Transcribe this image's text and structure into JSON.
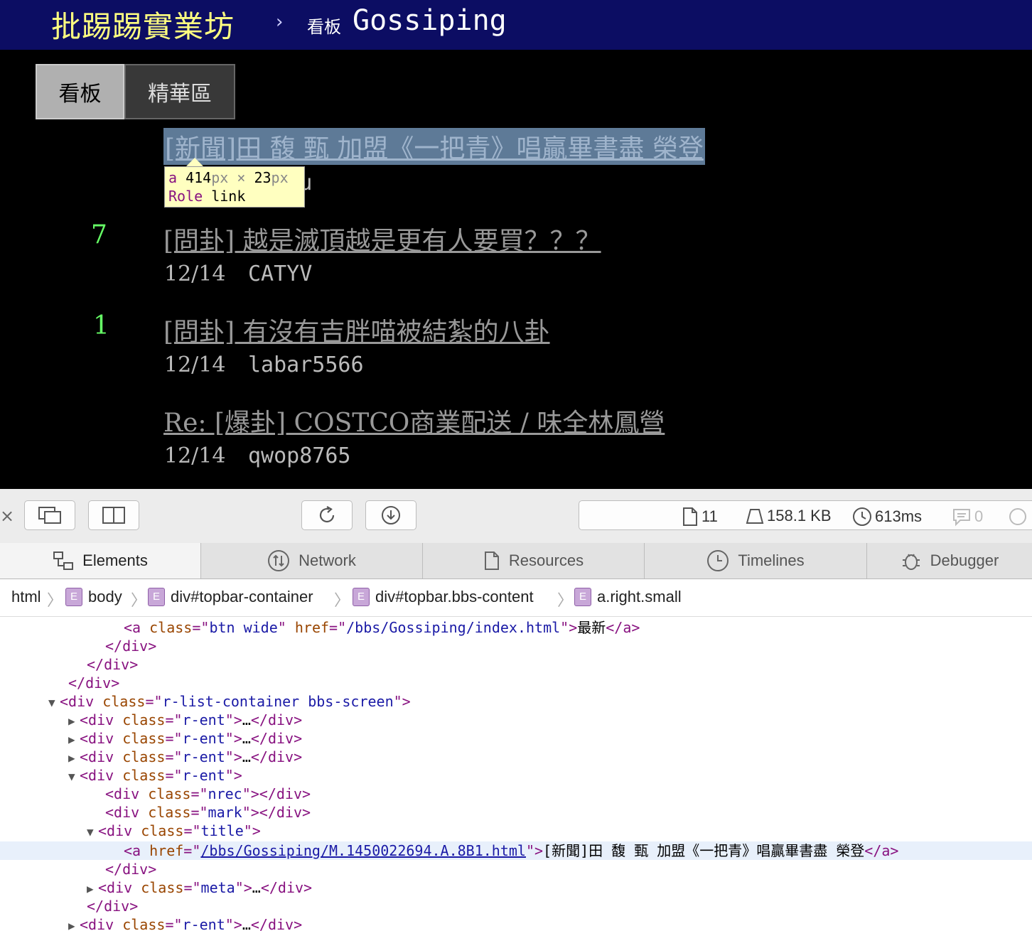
{
  "topbar": {
    "site_title": "批踢踢實業坊",
    "chevron": "›",
    "board_label": "看板",
    "board_name": "Gossiping"
  },
  "tabs": {
    "board": "看板",
    "digest": "精華區"
  },
  "entries": [
    {
      "nrec": "",
      "title": "[新聞]田 馥 甄 加盟《一把青》唱贏畢書盡 榮登",
      "date": "",
      "author": "englu"
    },
    {
      "nrec": "7",
      "title": "[問卦] 越是滅頂越是更有人要買？？？",
      "date": "12/14",
      "author": "CATYV"
    },
    {
      "nrec": "1",
      "title": "[問卦] 有沒有吉胖喵被結紮的八卦",
      "date": "12/14",
      "author": "labar5566"
    },
    {
      "nrec": "",
      "title": "Re: [爆卦] COSTCO商業配送 / 味全林鳳營",
      "date": "12/14",
      "author": "qwop8765"
    }
  ],
  "tooltip": {
    "tag": "a",
    "width": "414",
    "height": "23",
    "unit": "px",
    "times": "×",
    "role_label": "Role",
    "role_value": "link"
  },
  "devtools": {
    "close": "×",
    "stats": {
      "resources": "11",
      "size": "158.1 KB",
      "time": "613ms",
      "messages": "0"
    },
    "tabs": [
      "Elements",
      "Network",
      "Resources",
      "Timelines",
      "Debugger"
    ],
    "breadcrumbs": [
      "html",
      "body",
      "div#topbar-container",
      "div#topbar.bbs-content",
      "a.right.small"
    ],
    "badge": "E",
    "dom": {
      "l0_text": "最新",
      "l4_class": "r-list-container bbs-screen",
      "r_ent": "r-ent",
      "ellipsis": "…",
      "nrec": "nrec",
      "mark": "mark",
      "title": "title",
      "meta": "meta",
      "btn_class": "btn wide",
      "btn_href": "/bbs/Gossiping/index.html",
      "sel_href": "/bbs/Gossiping/M.1450022694.A.8B1.html",
      "sel_text": "[新聞]田 馥 甄 加盟《一把青》唱贏畢書盡 榮登"
    }
  }
}
